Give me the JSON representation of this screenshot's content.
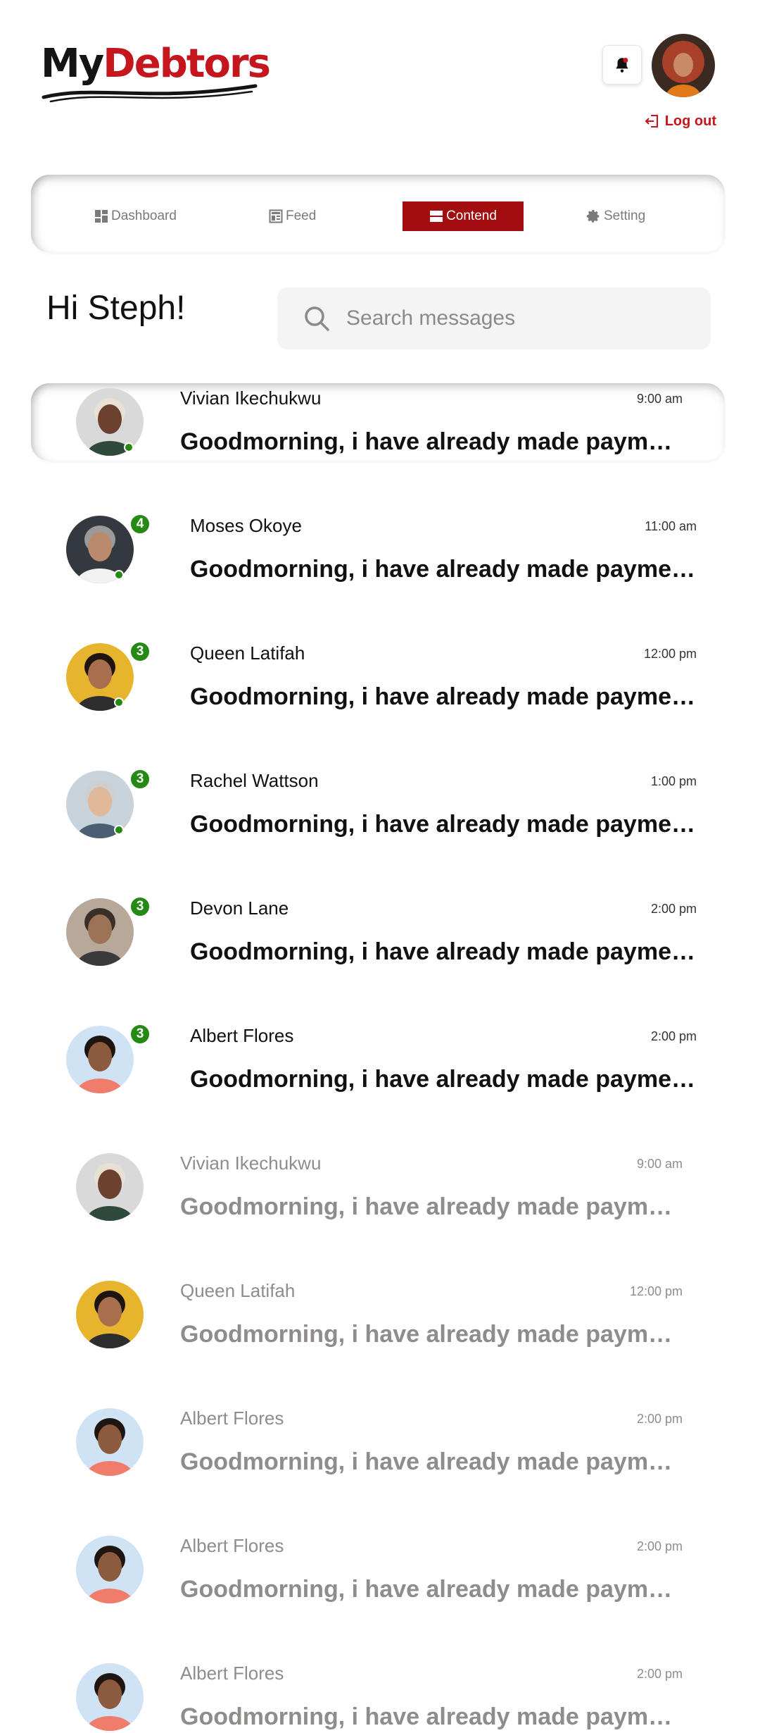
{
  "app": {
    "logo_part1": "My",
    "logo_part2": "Debtors",
    "brand_color": "#c4161c"
  },
  "header": {
    "notification_icon": "bell-icon",
    "logout_label": "Log out"
  },
  "nav": {
    "tabs": [
      {
        "label": "Dashboard",
        "icon": "dashboard-icon",
        "active": false
      },
      {
        "label": "Feed",
        "icon": "feed-icon",
        "active": false
      },
      {
        "label": "Contend",
        "icon": "contend-icon",
        "active": true
      },
      {
        "label": "Setting",
        "icon": "gear-icon",
        "active": false
      }
    ],
    "active_color": "#a30d0f"
  },
  "greeting": "Hi Steph!",
  "search": {
    "placeholder": "Search messages"
  },
  "messages": [
    {
      "name": "Vivian Ikechukwu",
      "time": "9:00 am",
      "text": "Goodmorning, i have already made payment...",
      "unread": "",
      "online": true,
      "read": false,
      "highlighted": true
    },
    {
      "name": "Moses Okoye",
      "time": "11:00 am",
      "text": "Goodmorning, i have already made payment...",
      "unread": "4",
      "online": true,
      "read": false,
      "highlighted": false
    },
    {
      "name": "Queen Latifah",
      "time": "12:00 pm",
      "text": "Goodmorning, i have already made payment...",
      "unread": "3",
      "online": true,
      "read": false,
      "highlighted": false
    },
    {
      "name": "Rachel Wattson",
      "time": "1:00 pm",
      "text": "Goodmorning, i have already made payment...",
      "unread": "3",
      "online": true,
      "read": false,
      "highlighted": false
    },
    {
      "name": "Devon Lane",
      "time": "2:00 pm",
      "text": "Goodmorning, i have already made payment...",
      "unread": "3",
      "online": false,
      "read": false,
      "highlighted": false
    },
    {
      "name": "Albert Flores",
      "time": "2:00 pm",
      "text": "Goodmorning, i have already made payment...",
      "unread": "3",
      "online": false,
      "read": false,
      "highlighted": false
    },
    {
      "name": "Vivian Ikechukwu",
      "time": "9:00 am",
      "text": "Goodmorning, i have already made payment...",
      "unread": "",
      "online": false,
      "read": true,
      "highlighted": false
    },
    {
      "name": "Queen Latifah",
      "time": "12:00 pm",
      "text": "Goodmorning, i have already made payment...",
      "unread": "",
      "online": false,
      "read": true,
      "highlighted": false
    },
    {
      "name": "Albert Flores",
      "time": "2:00 pm",
      "text": "Goodmorning, i have already made payment...",
      "unread": "",
      "online": false,
      "read": true,
      "highlighted": false
    },
    {
      "name": "Albert Flores",
      "time": "2:00 pm",
      "text": "Goodmorning, i have already made payment...",
      "unread": "",
      "online": false,
      "read": true,
      "highlighted": false
    },
    {
      "name": "Albert Flores",
      "time": "2:00 pm",
      "text": "Goodmorning, i have already made payment...",
      "unread": "",
      "online": false,
      "read": true,
      "highlighted": false
    }
  ],
  "colors": {
    "online": "#248a14",
    "read_text": "#8f8c8c"
  }
}
